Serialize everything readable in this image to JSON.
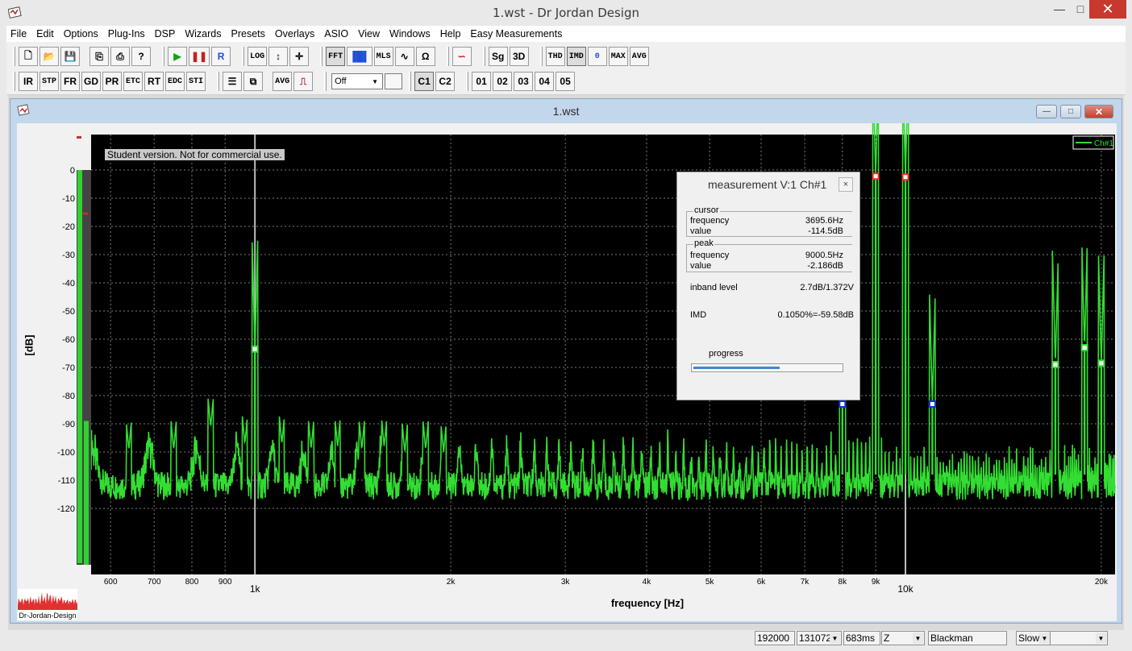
{
  "app": {
    "title": "1.wst - Dr Jordan Design",
    "window_controls": {
      "minimize": "—",
      "maximize": "□",
      "close": "✕"
    }
  },
  "menu": [
    "File",
    "Edit",
    "Options",
    "Plug-Ins",
    "DSP",
    "Wizards",
    "Presets",
    "Overlays",
    "ASIO",
    "View",
    "Windows",
    "Help",
    "Easy Measurements"
  ],
  "toolbar": {
    "row1": {
      "file_buttons": [
        {
          "name": "new-icon",
          "glyph": "🗋"
        },
        {
          "name": "open-folder-icon",
          "glyph": "📂"
        },
        {
          "name": "save-icon",
          "glyph": "💾"
        }
      ],
      "edit_buttons": [
        {
          "name": "copy-icon",
          "glyph": "⎘"
        },
        {
          "name": "print-icon",
          "glyph": "⎙"
        },
        {
          "name": "help-icon",
          "glyph": "?"
        }
      ],
      "transport": [
        {
          "name": "play-icon",
          "glyph": "▶",
          "color": "green"
        },
        {
          "name": "pause-icon",
          "glyph": "❚❚",
          "color": "red"
        },
        {
          "name": "record-label",
          "glyph": "R",
          "color": "blue"
        }
      ],
      "view_tools": [
        {
          "name": "log-button",
          "label": "LOG"
        },
        {
          "name": "vertical-arrow-icon",
          "glyph": "↕"
        },
        {
          "name": "pan-move-icon",
          "glyph": "✛"
        }
      ],
      "analysis": [
        {
          "name": "fft-button",
          "label": "FFT"
        },
        {
          "name": "spectrum-bars-icon",
          "glyph": "▐█▌"
        },
        {
          "name": "mls-button",
          "label": "MLS"
        },
        {
          "name": "sine-wave-icon",
          "glyph": "∿"
        },
        {
          "name": "ohm-icon",
          "glyph": "Ω"
        }
      ],
      "gen_tools": [
        {
          "name": "waveform-color-icon",
          "glyph": "∽"
        }
      ],
      "sg3d": [
        "Sg",
        "3D"
      ],
      "measures": [
        {
          "name": "thd-button",
          "label": "THD"
        },
        {
          "name": "imd-button",
          "label": "IMD"
        },
        {
          "name": "zero-button",
          "label": "0"
        },
        {
          "name": "max-button",
          "label": "MAX"
        },
        {
          "name": "avg-button",
          "label": "AVG"
        }
      ]
    },
    "row2": {
      "modes": [
        "IR",
        "STP",
        "FR",
        "GD",
        "PR",
        "ETC",
        "RT",
        "EDC",
        "STI"
      ],
      "misc": [
        {
          "name": "marker-tool-icon",
          "glyph": "☰"
        },
        {
          "name": "cascade-windows-icon",
          "glyph": "⧉"
        }
      ],
      "avg_label": "AVG",
      "pulse_icon": "pulse-step-icon",
      "dropdown_value": "Off",
      "channels": [
        "C1",
        "C2"
      ],
      "presets": [
        "01",
        "02",
        "03",
        "04",
        "05"
      ]
    }
  },
  "child_window": {
    "title": "1.wst",
    "controls": {
      "minimize": "—",
      "maximize": "□",
      "close": "✕"
    }
  },
  "student_note": "Student version. Not for commercial use.",
  "logo_text": "Dr-Jordan-Design",
  "legend": "Ch#1",
  "colors": {
    "trace": "#33dd33",
    "plot_bg": "#000000",
    "peak_marker": "#ff2a2a",
    "harmonic_marker": "#1a2ee0",
    "grid": "#7a7a7a",
    "accent": "#3f87d4"
  },
  "chart_data": {
    "type": "line",
    "xlabel": "frequency [Hz]",
    "ylabel": "[dB]",
    "x_scale": "log",
    "xlim": [
      560,
      21000
    ],
    "ylim": [
      -140,
      10
    ],
    "y_ticks": [
      "0",
      "-10",
      "-20",
      "-30",
      "-40",
      "-50",
      "-60",
      "-70",
      "-80",
      "-90",
      "-100",
      "-110",
      "-120"
    ],
    "x_ticks": [
      {
        "v": 600,
        "label": "600"
      },
      {
        "v": 700,
        "label": "700"
      },
      {
        "v": 800,
        "label": "800"
      },
      {
        "v": 900,
        "label": "900"
      },
      {
        "v": 1000,
        "label": "1k"
      },
      {
        "v": 2000,
        "label": "2k"
      },
      {
        "v": 3000,
        "label": "3k"
      },
      {
        "v": 4000,
        "label": "4k"
      },
      {
        "v": 5000,
        "label": "5k"
      },
      {
        "v": 6000,
        "label": "6k"
      },
      {
        "v": 7000,
        "label": "7k"
      },
      {
        "v": 8000,
        "label": "8k"
      },
      {
        "v": 9000,
        "label": "9k"
      },
      {
        "v": 10000,
        "label": "10k"
      },
      {
        "v": 20000,
        "label": "20k"
      }
    ],
    "grid": true,
    "cursor_lines_hz": [
      1000,
      10000
    ],
    "noise_floor_db": -112,
    "noise_ripple_spacing_hz": 125,
    "series": [
      {
        "name": "Ch#1",
        "peaks": [
          {
            "freq": 1000,
            "db": -63.5,
            "marker": "green"
          },
          {
            "freq": 8000,
            "db": -83,
            "marker": "blue"
          },
          {
            "freq": 9000,
            "db": -2.2,
            "marker": "red"
          },
          {
            "freq": 10000,
            "db": -2.5,
            "marker": "red"
          },
          {
            "freq": 11000,
            "db": -83,
            "marker": "blue"
          },
          {
            "freq": 17000,
            "db": -69,
            "marker": "green"
          },
          {
            "freq": 18850,
            "db": -63,
            "marker": "green"
          },
          {
            "freq": 20000,
            "db": -68.5,
            "marker": "green"
          }
        ],
        "minor_peaks": [
          {
            "freq": 640,
            "db": -99
          },
          {
            "freq": 750,
            "db": -99
          },
          {
            "freq": 855,
            "db": -91
          },
          {
            "freq": 965,
            "db": -97
          },
          {
            "freq": 1100,
            "db": -97
          },
          {
            "freq": 1220,
            "db": -99
          },
          {
            "freq": 1340,
            "db": -98
          },
          {
            "freq": 1460,
            "db": -99
          },
          {
            "freq": 1580,
            "db": -98
          },
          {
            "freq": 1700,
            "db": -100
          },
          {
            "freq": 1830,
            "db": -99
          },
          {
            "freq": 1950,
            "db": -100
          }
        ]
      }
    ]
  },
  "level_meter": {
    "level_db": -89,
    "peak_hold_db": -15,
    "max_db": 0
  },
  "measurement_panel": {
    "title": "measurement V:1 Ch#1",
    "close": "×",
    "cursor": {
      "title": "cursor",
      "frequency_label": "frequency",
      "frequency": "3695.6Hz",
      "value_label": "value",
      "value": "-114.5dB"
    },
    "peak": {
      "title": "peak",
      "frequency_label": "frequency",
      "frequency": "9000.5Hz",
      "value_label": "value",
      "value": "-2.186dB"
    },
    "inband": {
      "label": "inband level",
      "value": "2.7dB/1.372V"
    },
    "imd": {
      "label": "IMD",
      "value": "0.1050%=-59.58dB"
    },
    "progress_label": "progress",
    "progress": 0.58
  },
  "statusbar": {
    "sample_rate": "192000",
    "fft_size": "131072",
    "duration": "683ms",
    "weighting": "Z",
    "window": "Blackman",
    "speed": "Slow",
    "extra": ""
  }
}
